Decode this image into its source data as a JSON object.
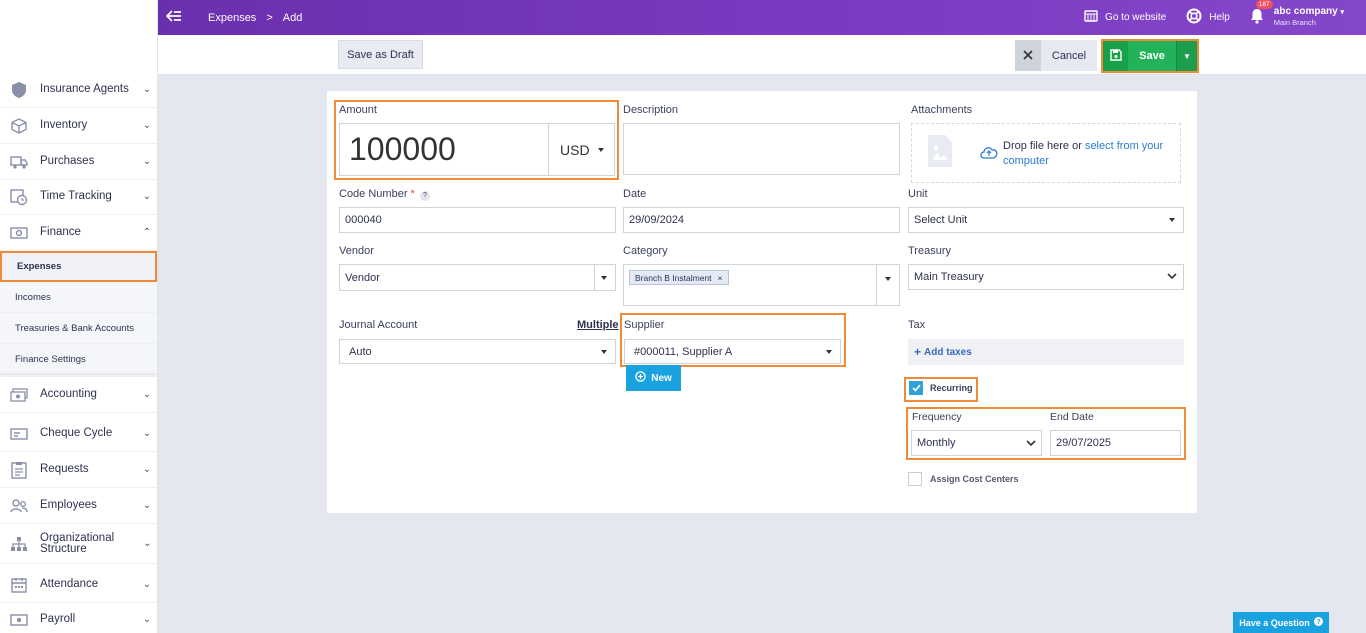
{
  "topbar": {
    "crumb_section": "Expenses",
    "crumb_sep": ">",
    "crumb_page": "Add",
    "go_website": "Go to website",
    "help": "Help",
    "notif_count": "187",
    "company_name": "abc company",
    "company_branch": "Main Branch"
  },
  "sidebar": {
    "items": [
      {
        "label": "Insurance Agents",
        "icon": "shield-icon"
      },
      {
        "label": "Inventory",
        "icon": "box-icon"
      },
      {
        "label": "Purchases",
        "icon": "truck-icon"
      },
      {
        "label": "Time Tracking",
        "icon": "clock-icon"
      },
      {
        "label": "Finance",
        "icon": "cash-icon"
      },
      {
        "label": "Accounting",
        "icon": "money-icon"
      },
      {
        "label": "Cheque Cycle",
        "icon": "cheque-icon"
      },
      {
        "label": "Requests",
        "icon": "clipboard-icon"
      },
      {
        "label": "Employees",
        "icon": "people-icon"
      },
      {
        "label": "Organizational Structure",
        "icon": "org-icon"
      },
      {
        "label": "Attendance",
        "icon": "calendar-icon"
      },
      {
        "label": "Payroll",
        "icon": "payroll-icon"
      }
    ],
    "finance_sub": [
      "Expenses",
      "Incomes",
      "Treasuries & Bank Accounts",
      "Finance Settings"
    ]
  },
  "actions": {
    "save_draft": "Save as Draft",
    "cancel": "Cancel",
    "save": "Save"
  },
  "form": {
    "amount_label": "Amount",
    "amount_value": "100000",
    "currency": "USD",
    "description_label": "Description",
    "attachments_label": "Attachments",
    "drop_text": "Drop file here or",
    "select_link_1": "select from your",
    "select_link_2": "computer",
    "code_label": "Code Number",
    "code_required": "*",
    "code_help": "?",
    "code_value": "000040",
    "date_label": "Date",
    "date_value": "29/09/2024",
    "unit_label": "Unit",
    "unit_value": "Select Unit",
    "vendor_label": "Vendor",
    "vendor_value": "Vendor",
    "category_label": "Category",
    "category_tag": "Branch B Instalment",
    "category_tag_remove": "×",
    "treasury_label": "Treasury",
    "treasury_value": "Main Treasury",
    "journal_label": "Journal Account",
    "multiple": "Multiple",
    "journal_value": "Auto",
    "supplier_label": "Supplier",
    "supplier_value": "#000011, Supplier A",
    "new_btn": "New",
    "tax_label": "Tax",
    "add_taxes": "Add taxes",
    "add_taxes_plus": "+",
    "recurring": "Recurring",
    "frequency_label": "Frequency",
    "frequency_value": "Monthly",
    "end_date_label": "End Date",
    "end_date_value": "29/07/2025",
    "cost_centers": "Assign Cost Centers"
  },
  "help_button": "Have a Question",
  "colors": {
    "topbar": "#7c3bc4",
    "save": "#22b35a",
    "highlight": "#f08a36",
    "link": "#2b7bd3",
    "new_btn": "#1aa1e0"
  }
}
